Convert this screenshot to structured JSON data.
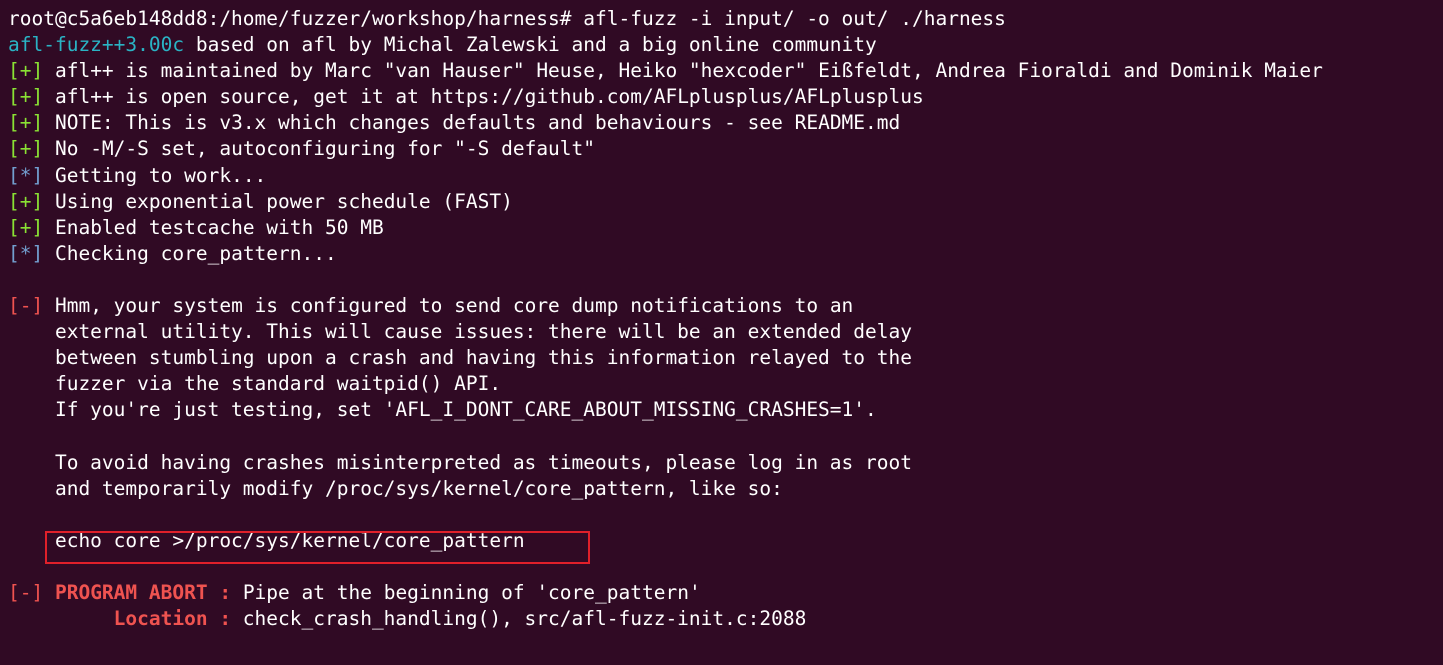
{
  "terminal": {
    "prompt_line": "root@c5a6eb148dd8:/home/fuzzer/workshop/harness# afl-fuzz -i input/ -o out/ ./harness",
    "banner": {
      "version": "afl-fuzz++3.00c",
      "rest": " based on afl by Michal Zalewski and a big online community"
    },
    "info": [
      {
        "tag": "[+]",
        "text": " afl++ is maintained by Marc \"van Hauser\" Heuse, Heiko \"hexcoder\" Eißfeldt, Andrea Fioraldi and Dominik Maier"
      },
      {
        "tag": "[+]",
        "text": " afl++ is open source, get it at https://github.com/AFLplusplus/AFLplusplus"
      },
      {
        "tag": "[+]",
        "text": " NOTE: This is v3.x which changes defaults and behaviours - see README.md"
      },
      {
        "tag": "[+]",
        "text": " No -M/-S set, autoconfiguring for \"-S default\""
      },
      {
        "tag": "[*]",
        "text": " Getting to work..."
      },
      {
        "tag": "[+]",
        "text": " Using exponential power schedule (FAST)"
      },
      {
        "tag": "[+]",
        "text": " Enabled testcache with 50 MB"
      },
      {
        "tag": "[*]",
        "text": " Checking core_pattern..."
      }
    ],
    "warning": {
      "tag": "[-]",
      "lines": [
        " Hmm, your system is configured to send core dump notifications to an",
        "    external utility. This will cause issues: there will be an extended delay",
        "    between stumbling upon a crash and having this information relayed to the",
        "    fuzzer via the standard waitpid() API.",
        "    If you're just testing, set 'AFL_I_DONT_CARE_ABOUT_MISSING_CRASHES=1'.",
        "",
        "    To avoid having crashes misinterpreted as timeouts, please log in as root",
        "    and temporarily modify /proc/sys/kernel/core_pattern, like so:",
        "",
        "    echo core >/proc/sys/kernel/core_pattern"
      ]
    },
    "abort": {
      "tag": "[-]",
      "label": " PROGRAM ABORT :",
      "text": " Pipe at the beginning of 'core_pattern'",
      "location_label": "         Location :",
      "location_text": " check_crash_handling(), src/afl-fuzz-init.c:2088"
    }
  },
  "colors": {
    "background": "#300a24",
    "green_tag": "#8ae234",
    "blue_tag": "#729fcf",
    "red_tag": "#ef5350",
    "cyan_version": "#2ab3c4",
    "highlight_border": "#e0202a"
  }
}
